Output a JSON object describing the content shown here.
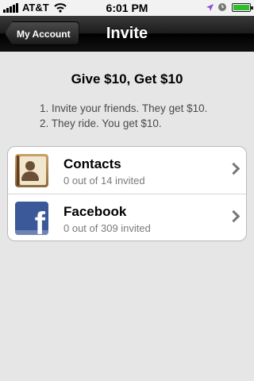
{
  "status_bar": {
    "carrier": "AT&T",
    "time": "6:01 PM",
    "icons": [
      "signal-bars-icon",
      "wifi-icon",
      "location-arrow-icon",
      "alarm-clock-icon",
      "battery-icon"
    ]
  },
  "nav": {
    "back_label": "My Account",
    "title": "Invite"
  },
  "promo": {
    "headline": "Give $10, Get $10",
    "step1": "1. Invite your friends. They get $10.",
    "step2": "2. They ride. You get $10."
  },
  "rows": [
    {
      "title": "Contacts",
      "subtitle": "0 out of 14 invited",
      "icon": "contacts-book-icon"
    },
    {
      "title": "Facebook",
      "subtitle": "0 out of 309 invited",
      "icon": "facebook-icon",
      "icon_letter": "f"
    }
  ],
  "colors": {
    "nav_bar": "#000000",
    "facebook_blue": "#3b5998",
    "battery_green": "#2fbd2c",
    "location_purple": "#8a4bd6"
  }
}
